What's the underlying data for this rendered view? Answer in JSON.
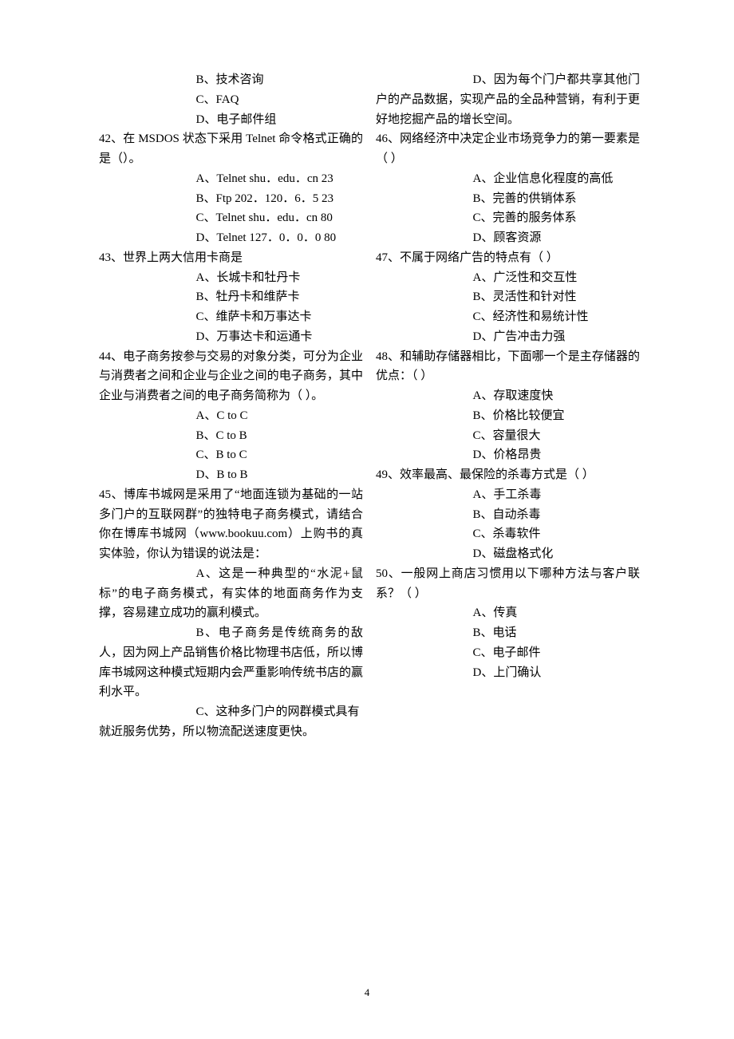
{
  "page_number": "4",
  "col1": {
    "q41": {
      "optB": "B、技术咨询",
      "optC": "C、FAQ",
      "optD": "D、电子邮件组"
    },
    "q42": {
      "stem": "42、在 MSDOS 状态下采用 Telnet 命令格式正确的是（）。",
      "optA": "A、Telnet shu．edu．cn 23",
      "optB": "B、Ftp 202．120．6．5 23",
      "optC": "C、Telnet shu．edu．cn 80",
      "optD": "D、Telnet 127．0．0．0 80"
    },
    "q43": {
      "stem": "43、世界上两大信用卡商是",
      "optA": "A、长城卡和牡丹卡",
      "optB": "B、牡丹卡和维萨卡",
      "optC": "C、维萨卡和万事达卡",
      "optD": "D、万事达卡和运通卡"
    },
    "q44": {
      "stem": "44、电子商务按参与交易的对象分类，可分为企业与消费者之间和企业与企业之间的电子商务，其中企业与消费者之间的电子商务简称为（ ）。",
      "optA": "A、C to C",
      "optB": "B、C to B",
      "optC": "C、B to C",
      "optD": "D、B to B"
    },
    "q45": {
      "stem": "45、博库书城网是采用了“地面连锁为基础的一站多门户的互联网群”的独特电子商务模式，请结合你在博库书城网（www.bookuu.com）上购书的真实体验，你认为错误的说法是：",
      "optA": "A、这是一种典型的“水泥+鼠标”的电子商务模式，有实体的地面商务作为支撑，容易建立成功的赢利模式。",
      "optB": "B、电子商务是传统商务的敌人，因为网上产品销售价格比物理书店低，所以博库书城网这种模式短期内会严重影响传统书店的赢利水平。",
      "optC": "C、这种多门户的网群模式具有"
    }
  },
  "col2": {
    "q45": {
      "optC2": "就近服务优势，所以物流配送速度更快。",
      "optD": "D、因为每个门户都共享其他门户的产品数据，实现产品的全品种营销，有利于更好地挖掘产品的增长空间。"
    },
    "q46": {
      "stem": "46、网络经济中决定企业市场竞争力的第一要素是（ ）",
      "optA": "A、企业信息化程度的高低",
      "optB": "B、完善的供销体系",
      "optC": "C、完善的服务体系",
      "optD": "D、顾客资源"
    },
    "q47": {
      "stem": "47、不属于网络广告的特点有（ ）",
      "optA": "A、广泛性和交互性",
      "optB": "B、灵活性和针对性",
      "optC": "C、经济性和易统计性",
      "optD": "D、广告冲击力强"
    },
    "q48": {
      "stem": "48、和辅助存储器相比，下面哪一个是主存储器的优点：（ ）",
      "optA": "A、存取速度快",
      "optB": "B、价格比较便宜",
      "optC": "C、容量很大",
      "optD": "D、价格昂贵"
    },
    "q49": {
      "stem": "49、效率最高、最保险的杀毒方式是（ ）",
      "optA": "A、手工杀毒",
      "optB": "B、自动杀毒",
      "optC": "C、杀毒软件",
      "optD": "D、磁盘格式化"
    },
    "q50": {
      "stem": "50、一般网上商店习惯用以下哪种方法与客户联系？（ ）",
      "optA": "A、传真",
      "optB": "B、电话",
      "optC": "C、电子邮件",
      "optD": "D、上门确认"
    }
  }
}
